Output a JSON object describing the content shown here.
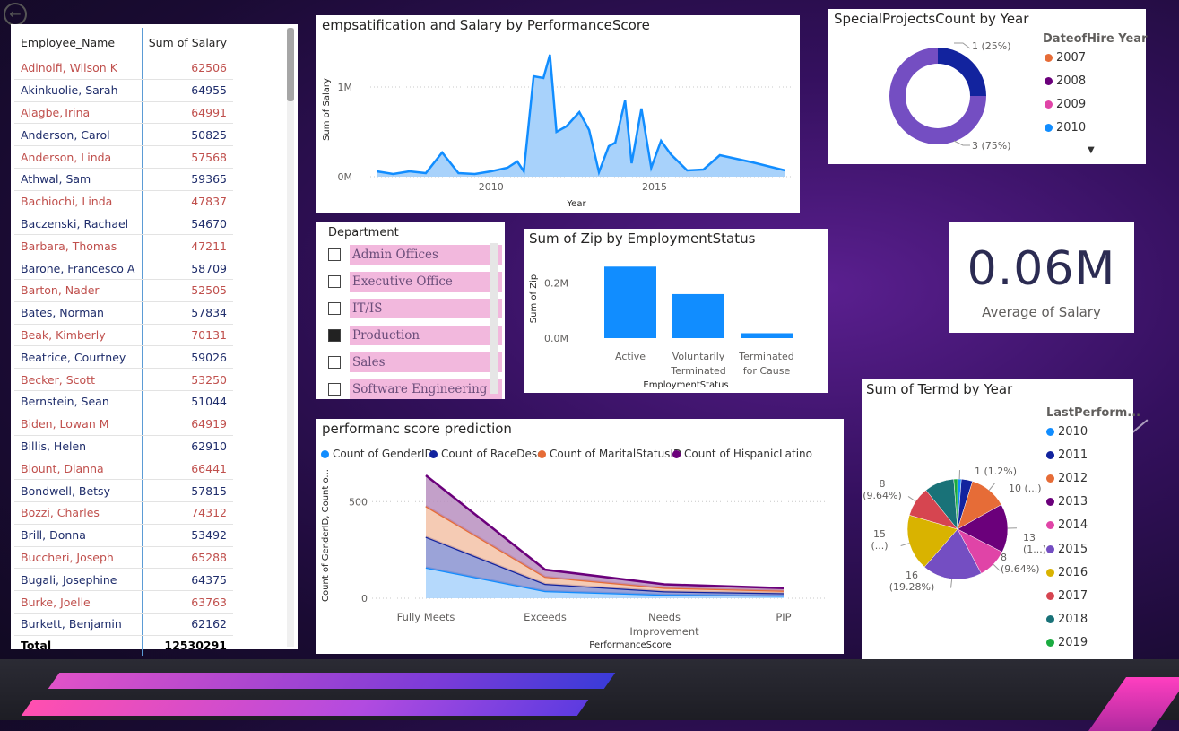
{
  "colors": {
    "accent": "#118dff",
    "red_text": "#c0504d",
    "navy_text": "#1f2d6b"
  },
  "nav": {
    "back_icon": "back-arrow-icon"
  },
  "table": {
    "headers": [
      "Employee_Name",
      "Sum of Salary"
    ],
    "rows": [
      {
        "name": "Adinolfi, Wilson K",
        "salary": "62506",
        "style": "red"
      },
      {
        "name": "Akinkuolie, Sarah",
        "salary": "64955",
        "style": "blue"
      },
      {
        "name": "Alagbe,Trina",
        "salary": "64991",
        "style": "red"
      },
      {
        "name": "Anderson, Carol",
        "salary": "50825",
        "style": "blue"
      },
      {
        "name": "Anderson, Linda",
        "salary": "57568",
        "style": "red"
      },
      {
        "name": "Athwal, Sam",
        "salary": "59365",
        "style": "blue"
      },
      {
        "name": "Bachiochi, Linda",
        "salary": "47837",
        "style": "red"
      },
      {
        "name": "Baczenski, Rachael",
        "salary": "54670",
        "style": "blue"
      },
      {
        "name": "Barbara, Thomas",
        "salary": "47211",
        "style": "red"
      },
      {
        "name": "Barone, Francesco A",
        "salary": "58709",
        "style": "blue"
      },
      {
        "name": "Barton, Nader",
        "salary": "52505",
        "style": "red"
      },
      {
        "name": "Bates, Norman",
        "salary": "57834",
        "style": "blue"
      },
      {
        "name": "Beak, Kimberly",
        "salary": "70131",
        "style": "red"
      },
      {
        "name": "Beatrice, Courtney",
        "salary": "59026",
        "style": "blue"
      },
      {
        "name": "Becker, Scott",
        "salary": "53250",
        "style": "red"
      },
      {
        "name": "Bernstein, Sean",
        "salary": "51044",
        "style": "blue"
      },
      {
        "name": "Biden, Lowan M",
        "salary": "64919",
        "style": "red"
      },
      {
        "name": "Billis, Helen",
        "salary": "62910",
        "style": "blue"
      },
      {
        "name": "Blount, Dianna",
        "salary": "66441",
        "style": "red"
      },
      {
        "name": "Bondwell, Betsy",
        "salary": "57815",
        "style": "blue"
      },
      {
        "name": "Bozzi, Charles",
        "salary": "74312",
        "style": "red"
      },
      {
        "name": "Brill, Donna",
        "salary": "53492",
        "style": "blue"
      },
      {
        "name": "Buccheri, Joseph",
        "salary": "65288",
        "style": "red"
      },
      {
        "name": "Bugali, Josephine",
        "salary": "64375",
        "style": "blue"
      },
      {
        "name": "Burke, Joelle",
        "salary": "63763",
        "style": "red"
      },
      {
        "name": "Burkett, Benjamin",
        "salary": "62162",
        "style": "blue"
      }
    ],
    "total_label": "Total",
    "total_value": "12530291"
  },
  "area_chart": {
    "title": "empsatification and Salary by PerformanceScore"
  },
  "donut": {
    "title": "SpecialProjectsCount by Year",
    "legend_title": "DateofHire Year",
    "legend": [
      {
        "label": "2007",
        "color": "#e66c37"
      },
      {
        "label": "2008",
        "color": "#6b007b"
      },
      {
        "label": "2009",
        "color": "#e044a7"
      },
      {
        "label": "2010",
        "color": "#118dff"
      }
    ],
    "more_icon": "caret-down-icon"
  },
  "department": {
    "title": "Department",
    "items": [
      {
        "label": "Admin Offices",
        "checked": false
      },
      {
        "label": "Executive Office",
        "checked": false
      },
      {
        "label": "IT/IS",
        "checked": false
      },
      {
        "label": "Production",
        "checked": true
      },
      {
        "label": "Sales",
        "checked": false
      },
      {
        "label": "Software Engineering",
        "checked": false
      }
    ]
  },
  "bar_chart": {
    "title": "Sum of Zip by EmploymentStatus"
  },
  "card": {
    "value": "0.06M",
    "label": "Average of Salary"
  },
  "perf_chart": {
    "title": "performanc score prediction",
    "legend": [
      {
        "label": "Count of GenderID",
        "color": "#118dff"
      },
      {
        "label": "Count of RaceDesc",
        "color": "#12239e"
      },
      {
        "label": "Count of MaritalStatusID",
        "color": "#e66c37"
      },
      {
        "label": "Count of HispanicLatino",
        "color": "#6b007b"
      }
    ]
  },
  "pie": {
    "title": "Sum of Termd by Year",
    "legend_title": "LastPerform...",
    "legend": [
      {
        "label": "2010",
        "color": "#118dff"
      },
      {
        "label": "2011",
        "color": "#12239e"
      },
      {
        "label": "2012",
        "color": "#e66c37"
      },
      {
        "label": "2013",
        "color": "#6b007b"
      },
      {
        "label": "2014",
        "color": "#e044a7"
      },
      {
        "label": "2015",
        "color": "#744ec2"
      },
      {
        "label": "2016",
        "color": "#d9b300"
      },
      {
        "label": "2017",
        "color": "#d64550"
      },
      {
        "label": "2018",
        "color": "#197278"
      },
      {
        "label": "2019",
        "color": "#1aab40"
      }
    ]
  },
  "chart_data": [
    {
      "type": "area",
      "title": "empsatification and Salary by PerformanceScore",
      "xlabel": "Year",
      "ylabel": "Sum of Salary",
      "xlim": [
        2006.3,
        2019.2
      ],
      "ylim": [
        0,
        1500000
      ],
      "x_ticks": [
        2010,
        2015
      ],
      "x_tick_labels": [
        "2010",
        "2015"
      ],
      "y_ticks": [
        0,
        1000000
      ],
      "y_tick_labels": [
        "0M",
        "1M"
      ],
      "x": [
        2006.5,
        2007,
        2007.5,
        2008,
        2008.5,
        2009,
        2009.5,
        2010,
        2010.5,
        2010.8,
        2011,
        2011.3,
        2011.6,
        2011.8,
        2012,
        2012.3,
        2012.7,
        2013,
        2013.3,
        2013.6,
        2013.8,
        2014.1,
        2014.3,
        2014.6,
        2014.9,
        2015.2,
        2015.5,
        2016,
        2016.5,
        2017,
        2018,
        2019
      ],
      "y": [
        60000,
        30000,
        60000,
        40000,
        270000,
        40000,
        30000,
        60000,
        100000,
        170000,
        60000,
        1120000,
        1100000,
        1360000,
        500000,
        560000,
        720000,
        520000,
        50000,
        340000,
        380000,
        850000,
        150000,
        760000,
        100000,
        400000,
        250000,
        70000,
        80000,
        240000,
        160000,
        70000
      ],
      "grid": true
    },
    {
      "type": "pie",
      "title": "SpecialProjectsCount by Year",
      "values": [
        1,
        3
      ],
      "labels": [
        "1 (25%)",
        "3 (75%)"
      ],
      "colors": [
        "#12239e",
        "#744ec2"
      ],
      "donut": true,
      "legend_placement": "right"
    },
    {
      "type": "bar",
      "title": "Sum of Zip by EmploymentStatus",
      "categories": [
        "Active",
        "Voluntarily Terminated",
        "Terminated for Cause"
      ],
      "values": [
        260000,
        160000,
        18000
      ],
      "xlabel": "EmploymentStatus",
      "ylabel": "Sum of Zip",
      "ylim": [
        0,
        300000
      ],
      "y_ticks": [
        0,
        200000
      ],
      "y_tick_labels": [
        "0.0M",
        "0.2M"
      ],
      "color": "#118dff"
    },
    {
      "type": "area",
      "title": "performanc score prediction",
      "categories": [
        "Fully Meets",
        "Exceeds",
        "Needs Improvement",
        "PIP"
      ],
      "xlabel": "PerformanceScore",
      "ylabel": "Count of GenderID, Count o...",
      "ylim": [
        0,
        650
      ],
      "y_ticks": [
        0,
        500
      ],
      "y_tick_labels": [
        "0",
        "500"
      ],
      "stacked": true,
      "series": [
        {
          "name": "Count of GenderID",
          "values": [
            159,
            37,
            18,
            13
          ],
          "color": "#118dff"
        },
        {
          "name": "Count of RaceDesc",
          "values": [
            159,
            37,
            18,
            13
          ],
          "color": "#12239e"
        },
        {
          "name": "Count of MaritalStatusID",
          "values": [
            159,
            37,
            18,
            13
          ],
          "color": "#e66c37"
        },
        {
          "name": "Count of HispanicLatino",
          "values": [
            159,
            37,
            18,
            13
          ],
          "color": "#6b007b"
        }
      ],
      "legend_placement": "top-left"
    },
    {
      "type": "pie",
      "title": "Sum of Termd by Year",
      "values": [
        1,
        3,
        10,
        13,
        8,
        16,
        15,
        8,
        8,
        1
      ],
      "labels": [
        "1 (1.2%)",
        "",
        "10 (...)",
        "13 (1...)",
        "8 (9.64%)",
        "16 (19.28%)",
        "15 (...)",
        "8 (9.64%)",
        "",
        ""
      ],
      "label_lines": [
        [
          "1 (1.2%)"
        ],
        [],
        [
          "10 (...)"
        ],
        [
          "13",
          "(1...)"
        ],
        [
          "8",
          "(9.64%)"
        ],
        [
          "16",
          "(19.28%)"
        ],
        [
          "15",
          "(...)"
        ],
        [
          "8",
          "(9.64%)"
        ],
        [],
        []
      ],
      "colors": [
        "#118dff",
        "#12239e",
        "#e66c37",
        "#6b007b",
        "#e044a7",
        "#744ec2",
        "#d9b300",
        "#d64550",
        "#197278",
        "#1aab40"
      ],
      "legend_placement": "right"
    }
  ]
}
